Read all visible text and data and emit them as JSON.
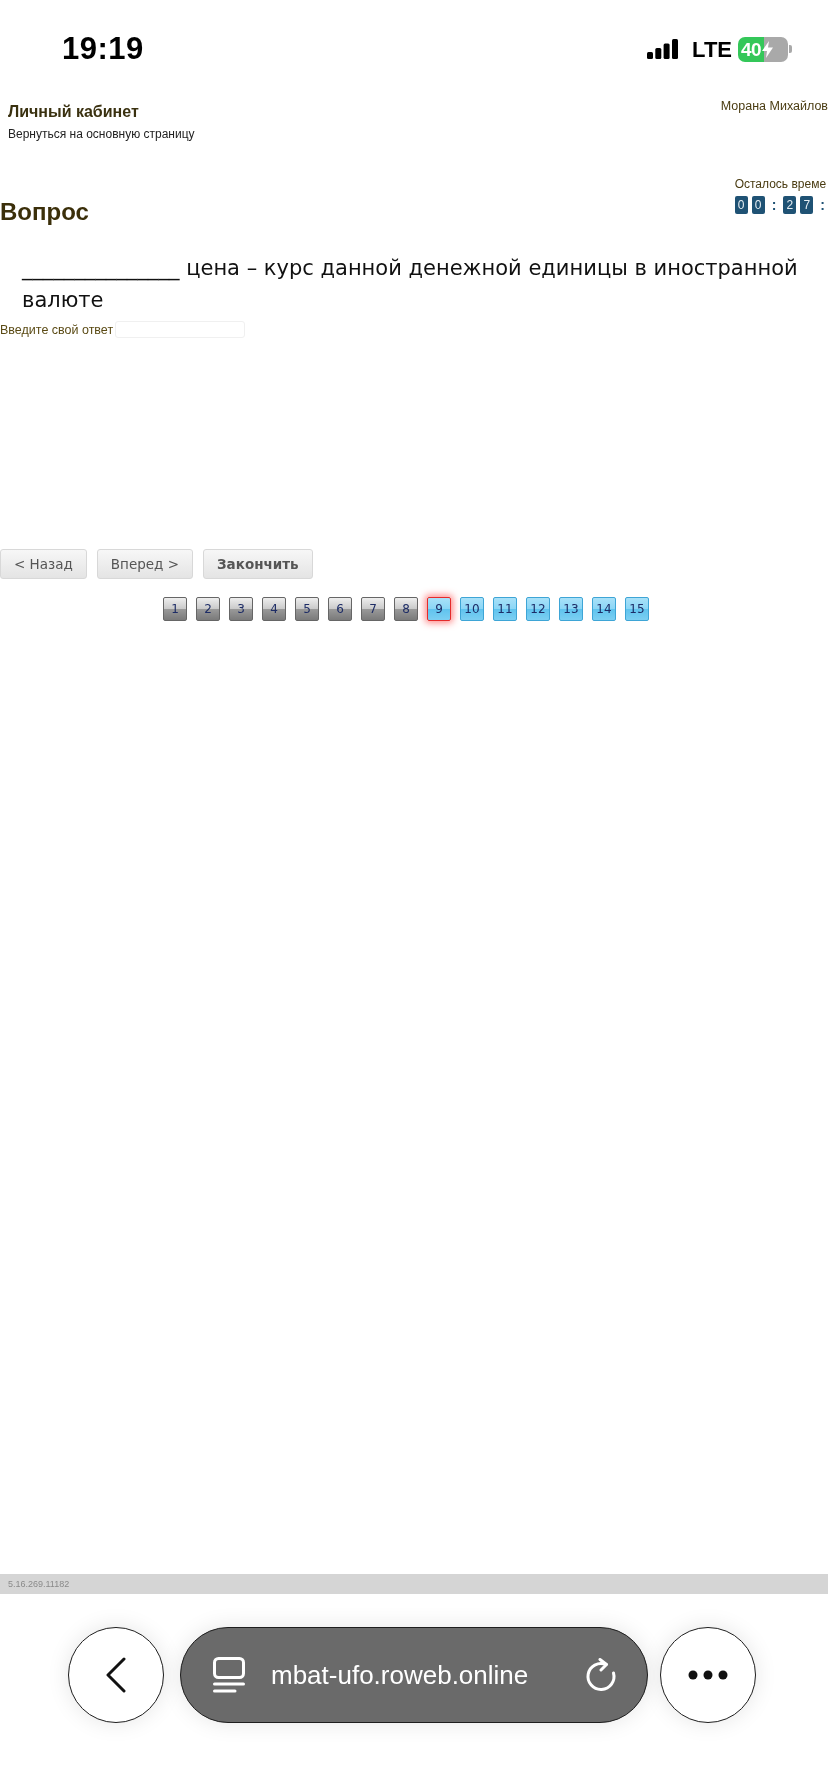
{
  "status_bar": {
    "time": "19:19",
    "network": "LTE",
    "battery": "40"
  },
  "header": {
    "title": "Личный кабинет",
    "back_link": "Вернуться на основную страницу",
    "user": "Морана Михайлов"
  },
  "timer": {
    "label": "Осталось време",
    "parts": [
      {
        "kind": "digit",
        "text": "0"
      },
      {
        "kind": "digit",
        "text": "0"
      },
      {
        "kind": "separator",
        "text": ":"
      },
      {
        "kind": "digit",
        "text": "2"
      },
      {
        "kind": "digit",
        "text": "7"
      },
      {
        "kind": "separator",
        "text": ":"
      }
    ]
  },
  "question": {
    "heading": "Вопрос",
    "text": "_______________ цена – курс данной денежной единицы в иностранной валюте",
    "answer_label": "Введите свой ответ"
  },
  "buttons": [
    {
      "kind": "nav",
      "label": "< Назад"
    },
    {
      "kind": "nav",
      "label": "Вперед >"
    },
    {
      "kind": "finish",
      "label": "Закончить"
    }
  ],
  "pages": [
    {
      "label": "1",
      "answered": true,
      "selected": false
    },
    {
      "label": "2",
      "answered": true,
      "selected": false
    },
    {
      "label": "3",
      "answered": true,
      "selected": false
    },
    {
      "label": "4",
      "answered": true,
      "selected": false
    },
    {
      "label": "5",
      "answered": true,
      "selected": false
    },
    {
      "label": "6",
      "answered": true,
      "selected": false
    },
    {
      "label": "7",
      "answered": true,
      "selected": false
    },
    {
      "label": "8",
      "answered": true,
      "selected": false
    },
    {
      "label": "9",
      "answered": false,
      "selected": true
    },
    {
      "label": "10",
      "answered": false,
      "selected": false
    },
    {
      "label": "11",
      "answered": false,
      "selected": false
    },
    {
      "label": "12",
      "answered": false,
      "selected": false
    },
    {
      "label": "13",
      "answered": false,
      "selected": false
    },
    {
      "label": "14",
      "answered": false,
      "selected": false
    },
    {
      "label": "15",
      "answered": false,
      "selected": false
    }
  ],
  "footer": {
    "version": "5.16.269.11182"
  },
  "browser": {
    "url": "mbat-ufo.roweb.online"
  }
}
